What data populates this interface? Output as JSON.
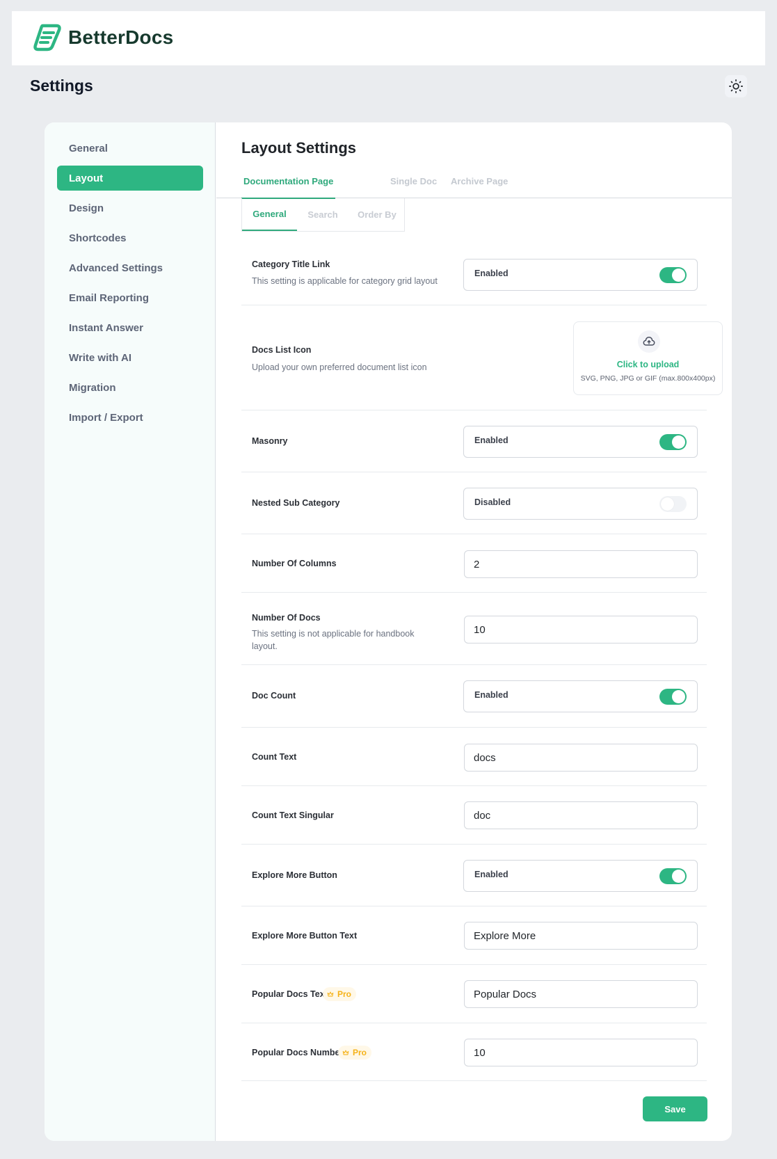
{
  "brand": {
    "name": "BetterDocs",
    "accent_color": "#2db683"
  },
  "header": {
    "title": "Settings",
    "theme_toggle_icon": "sun-icon"
  },
  "sidebar": {
    "items": [
      {
        "label": "General",
        "active": false
      },
      {
        "label": "Layout",
        "active": true
      },
      {
        "label": "Design",
        "active": false
      },
      {
        "label": "Shortcodes",
        "active": false
      },
      {
        "label": "Advanced Settings",
        "active": false
      },
      {
        "label": "Email Reporting",
        "active": false
      },
      {
        "label": "Instant Answer",
        "active": false
      },
      {
        "label": "Write with AI",
        "active": false
      },
      {
        "label": "Migration",
        "active": false
      },
      {
        "label": "Import / Export",
        "active": false
      }
    ]
  },
  "main": {
    "title": "Layout Settings",
    "tabs": [
      {
        "label": "Documentation Page",
        "active": true
      },
      {
        "label": "Single Doc",
        "active": false
      },
      {
        "label": "Archive Page",
        "active": false
      }
    ],
    "subtabs": [
      {
        "label": "General",
        "active": true
      },
      {
        "label": "Search",
        "active": false
      },
      {
        "label": "Order By",
        "active": false
      }
    ],
    "settings": {
      "category_title_link": {
        "label": "Category Title Link",
        "description": "This setting is applicable for category grid layout",
        "state_label": "Enabled",
        "enabled": true
      },
      "docs_list_icon": {
        "label": "Docs List Icon",
        "description": "Upload your own preferred document list icon",
        "upload_title": "Click to upload",
        "upload_hint": "SVG, PNG, JPG or GIF (max.800x400px)"
      },
      "masonry": {
        "label": "Masonry",
        "state_label": "Enabled",
        "enabled": true
      },
      "nested_sub_category": {
        "label": "Nested Sub Category",
        "state_label": "Disabled",
        "enabled": false
      },
      "number_of_columns": {
        "label": "Number Of Columns",
        "value": "2"
      },
      "number_of_docs": {
        "label": "Number Of Docs",
        "description": "This setting is not applicable for handbook layout.",
        "value": "10"
      },
      "doc_count": {
        "label": "Doc Count",
        "state_label": "Enabled",
        "enabled": true
      },
      "count_text": {
        "label": "Count Text",
        "value": "docs"
      },
      "count_text_singular": {
        "label": "Count Text Singular",
        "value": "doc"
      },
      "explore_more_button": {
        "label": "Explore More Button",
        "state_label": "Enabled",
        "enabled": true
      },
      "explore_more_button_text": {
        "label": "Explore More Button Text",
        "value": "Explore More"
      },
      "popular_docs_text": {
        "label": "Popular Docs Text",
        "badge": "Pro",
        "value": "Popular Docs"
      },
      "popular_docs_number": {
        "label": "Popular Docs Number",
        "badge": "Pro",
        "value": "10"
      }
    },
    "save_label": "Save"
  }
}
